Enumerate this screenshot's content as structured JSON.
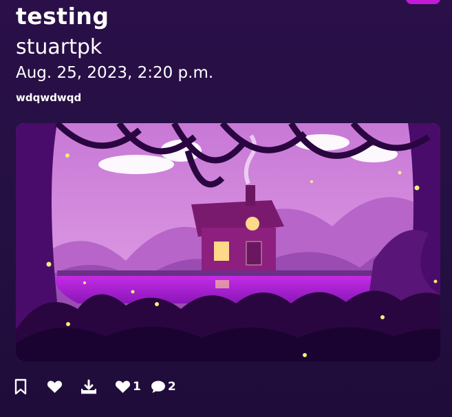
{
  "post": {
    "title": "testing",
    "author": "stuartpk",
    "date": "Aug. 25, 2023, 2:20 p.m.",
    "description": "wdqwdwqd"
  },
  "artwork": {
    "colors": {
      "sky": "#d58ce0",
      "hills": "#9a4cb3",
      "lake": "#b01fd8",
      "foliage": "#2a0640",
      "window": "#ffd98a",
      "firefly": "#f2f07a"
    }
  },
  "actions": {
    "bookmark_icon": "bookmark-icon",
    "like_icon": "heart-icon",
    "download_icon": "download-icon",
    "likes_count_icon": "heart-icon",
    "likes_count": "1",
    "comments_icon": "comment-icon",
    "comments_count": "2"
  },
  "accent": "#c21bd8"
}
